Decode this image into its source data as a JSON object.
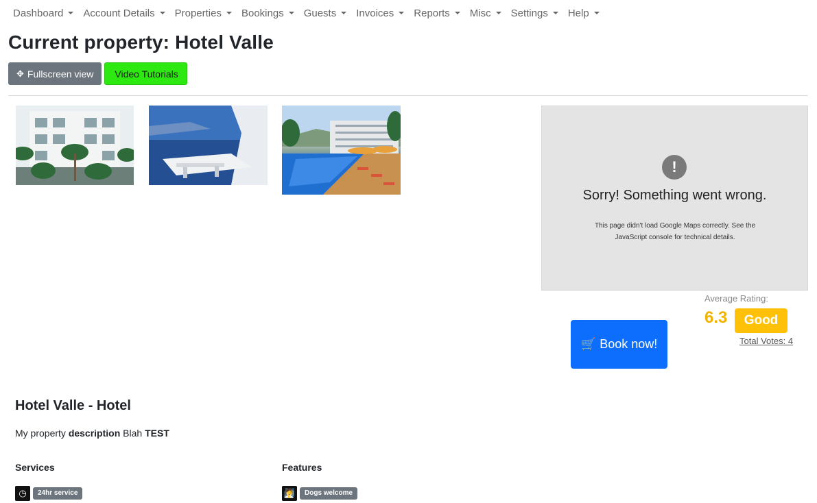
{
  "nav": {
    "items": [
      {
        "label": "Dashboard"
      },
      {
        "label": "Account Details"
      },
      {
        "label": "Properties"
      },
      {
        "label": "Bookings"
      },
      {
        "label": "Guests"
      },
      {
        "label": "Invoices"
      },
      {
        "label": "Reports"
      },
      {
        "label": "Misc"
      },
      {
        "label": "Settings"
      },
      {
        "label": "Help"
      }
    ]
  },
  "header": {
    "title": "Current property: Hotel Valle"
  },
  "toolbar": {
    "fullscreen_label": "Fullscreen view",
    "fullscreen_icon": "arrows-move-icon",
    "tutorials_label": "Video Tutorials",
    "tutorials_color": "#2ee812"
  },
  "map": {
    "error_heading": "Sorry! Something went wrong.",
    "error_text": "This page didn't load Google Maps correctly. See the JavaScript console for technical details.",
    "error_icon": "!"
  },
  "booking": {
    "book_label": "Book now!",
    "book_icon": "cart-icon",
    "color": "#0d6efd"
  },
  "rating": {
    "label": "Average Rating:",
    "score": "6.3",
    "badge": "Good",
    "votes": "Total Votes: 4",
    "color": "#ffc107"
  },
  "property": {
    "heading": "Hotel Valle - Hotel",
    "desc_prefix": "My property ",
    "desc_bold1": "description",
    "desc_mid": " Blah ",
    "desc_bold2": "TEST"
  },
  "services": {
    "title": "Services",
    "items": [
      {
        "label": "24hr service",
        "icon": "clock-icon"
      }
    ]
  },
  "features": {
    "title": "Features",
    "items": [
      {
        "label": "Dogs welcome",
        "icon": "dog-walking-icon"
      }
    ]
  }
}
